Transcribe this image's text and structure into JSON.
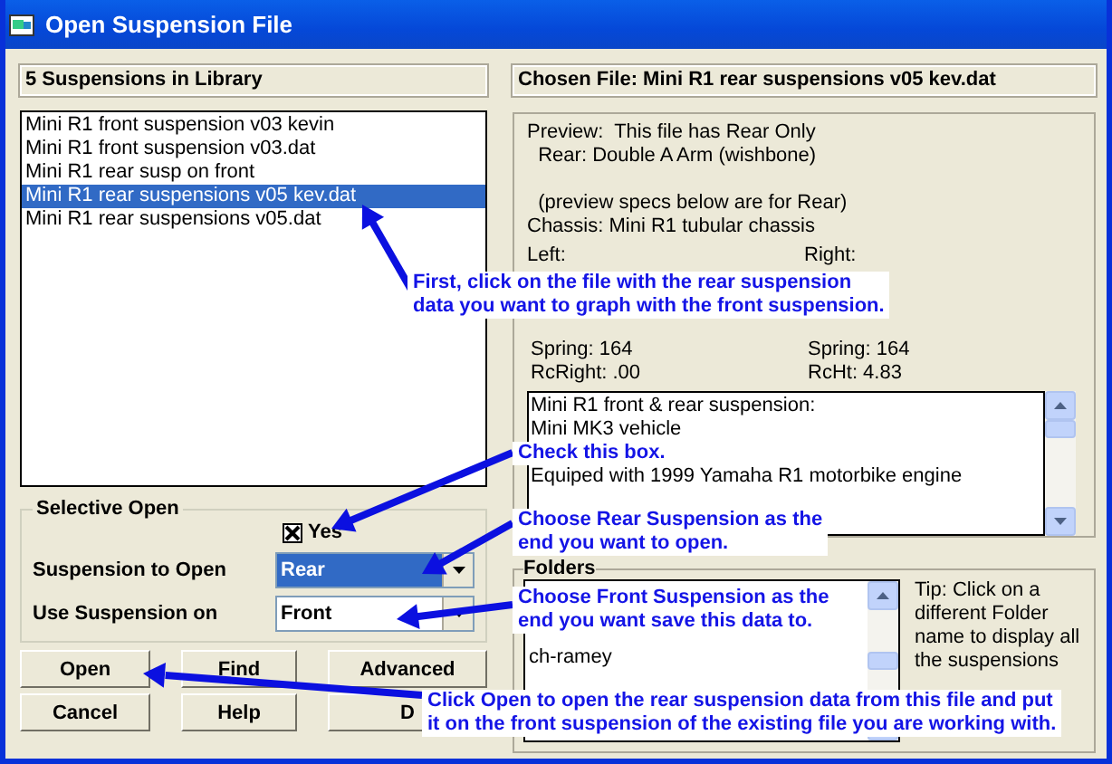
{
  "window": {
    "title": "Open Suspension File"
  },
  "library": {
    "header": "5 Suspensions in Library",
    "items": [
      {
        "label": "Mini R1 front suspension v03 kevin",
        "selected": false
      },
      {
        "label": "Mini R1 front suspension v03.dat",
        "selected": false
      },
      {
        "label": "Mini R1 rear susp on front",
        "selected": false
      },
      {
        "label": "Mini R1 rear suspensions v05 kev.dat",
        "selected": true
      },
      {
        "label": "Mini R1 rear suspensions v05.dat",
        "selected": false
      }
    ]
  },
  "selective_open": {
    "title": "Selective Open",
    "checkbox": {
      "label": "Yes",
      "checked": true
    },
    "fields": [
      {
        "label": "Suspension to Open",
        "value": "Rear",
        "focused": true
      },
      {
        "label": "Use Suspension on",
        "value": "Front",
        "focused": false
      }
    ]
  },
  "buttons": [
    [
      "Open",
      "Find",
      "Advanced"
    ],
    [
      "Cancel",
      "Help",
      "D"
    ]
  ],
  "chosen_file": "Chosen File: Mini R1 rear suspensions v05 kev.dat",
  "preview": {
    "lines": [
      "Preview:  This file has Rear Only",
      "  Rear: Double A Arm (wishbone)",
      "  (preview specs below are for Rear)",
      "Chassis: Mini R1 tubular chassis"
    ],
    "left": {
      "heading": "Left:",
      "rows": [
        "Spring: 164",
        "RcRight: .00"
      ]
    },
    "right": {
      "heading": "Right:",
      "rows": [
        "Spring: 164",
        "RcHt: 4.83"
      ]
    }
  },
  "notes": [
    "Mini R1 front & rear suspension:",
    "Mini MK3 vehicle",
    "Equiped with 1999 Yamaha R1 motorbike engine"
  ],
  "folders": {
    "title": "Folders",
    "items": [
      "ch-ramey"
    ],
    "tip": "Tip:  Click on a different Folder name to display all the suspensions"
  },
  "callouts": [
    {
      "lines": [
        "First, click on the file with the rear suspension",
        "data you want to graph with the front suspension."
      ]
    },
    {
      "lines": [
        "Check this box."
      ]
    },
    {
      "lines": [
        "Choose Rear Suspension as the",
        "end you want to open."
      ]
    },
    {
      "lines": [
        "Choose Front Suspension as the",
        "end you want save this data to."
      ]
    },
    {
      "lines": [
        "Click Open to open the rear suspension data from this file and put",
        "it on the front suspension of the existing file you are working with."
      ]
    }
  ]
}
